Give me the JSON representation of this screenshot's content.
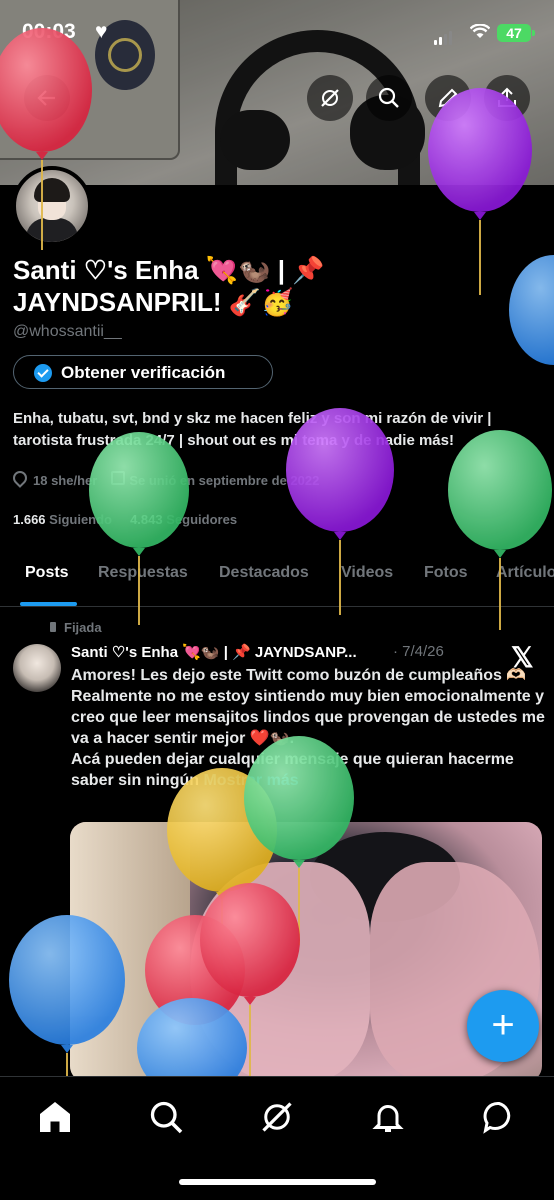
{
  "status_bar": {
    "time": "00:03",
    "battery": "47"
  },
  "colors": {
    "accent": "#1d9bf0",
    "background": "#000000",
    "muted": "#71767b"
  },
  "header_buttons": [
    "grok-icon",
    "search-icon",
    "edit-icon",
    "share-icon"
  ],
  "profile": {
    "name_line1": "Santi ♡'s Enha 💘🦦 | 📌",
    "name_line2": "JAYNDSANPRIL! 🎸🥳",
    "handle": "@whossantii__",
    "verify_label": "Obtener verificación",
    "bio": "Enha, tubatu, svt, bnd y skz me hacen feliz y son mi razón de vivir | tarotista frustrada 24/7 | shout out es mi tema y de nadie más!",
    "location": "18 she/her",
    "joined": "Se unió en septiembre de 2022",
    "following_count": "1.666",
    "following_label": "Siguiendo",
    "followers_count": "4.843",
    "followers_label": "Seguidores"
  },
  "tabs": [
    "Posts",
    "Respuestas",
    "Destacados",
    "Videos",
    "Fotos",
    "Artículos"
  ],
  "active_tab": "Posts",
  "post": {
    "pinned_label": "Fijada",
    "author": "Santi ♡'s Enha 💘🦦 | 📌 JAYNDSANP...",
    "date": "· 7/4/26",
    "line1": "Amores! Les dejo este Twitt como buzón de cumpleaños 🫶🏻",
    "line2": "Realmente no me estoy sintiendo muy bien emocionalmente y creo que leer mensajitos lindos que provengan de ustedes me va a hacer sentir mejor ❤️🦦.",
    "line3": "Acá pueden dejar cualquier mensaje que quieran hacerme saber sin ningún",
    "more": "Mostrar más"
  },
  "fab_label": "+",
  "bottom_nav": [
    "home-icon",
    "search-icon",
    "grok-icon",
    "notifications-icon",
    "messages-icon"
  ]
}
